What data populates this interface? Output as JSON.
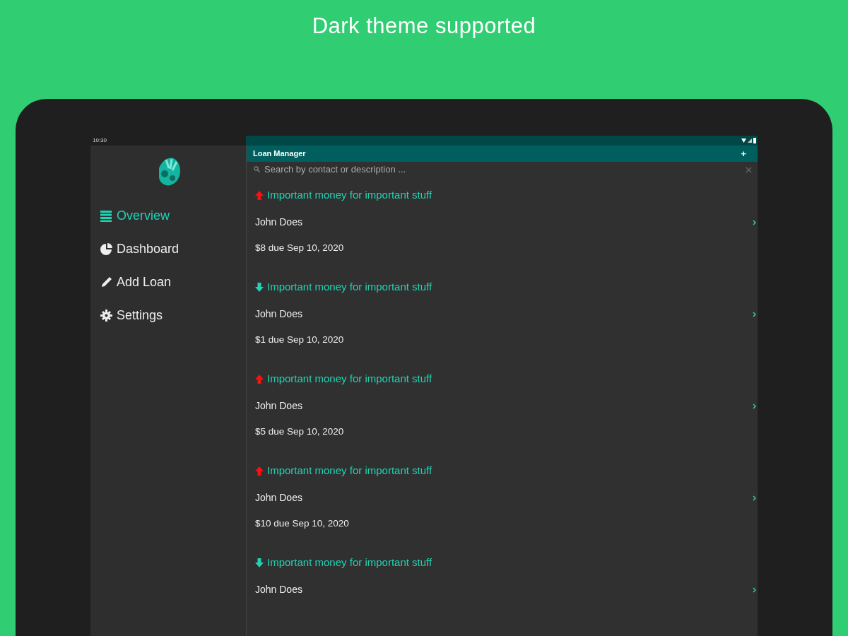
{
  "headline": "Dark theme supported",
  "status_bar": {
    "time": "10:30"
  },
  "drawer": {
    "items": [
      {
        "label": "Overview",
        "selected": true
      },
      {
        "label": "Dashboard",
        "selected": false
      },
      {
        "label": "Add Loan",
        "selected": false
      },
      {
        "label": "Settings",
        "selected": false
      }
    ]
  },
  "app_bar": {
    "title": "Loan Manager",
    "action": "+"
  },
  "search": {
    "placeholder": "Search by contact or description ..."
  },
  "loans": [
    {
      "kind": "lent",
      "description": "Important money for important stuff",
      "contact": "John Does",
      "amount": "$8 due Sep 10, 2020"
    },
    {
      "kind": "borrowed",
      "description": "Important money for important stuff",
      "contact": "John Does",
      "amount": "$1 due Sep 10, 2020"
    },
    {
      "kind": "lent",
      "description": "Important money for important stuff",
      "contact": "John Does",
      "amount": "$5 due Sep 10, 2020"
    },
    {
      "kind": "lent",
      "description": "Important money for important stuff",
      "contact": "John Does",
      "amount": "$10 due Sep 10, 2020"
    },
    {
      "kind": "borrowed",
      "description": "Important money for important stuff",
      "contact": "John Does"
    }
  ]
}
